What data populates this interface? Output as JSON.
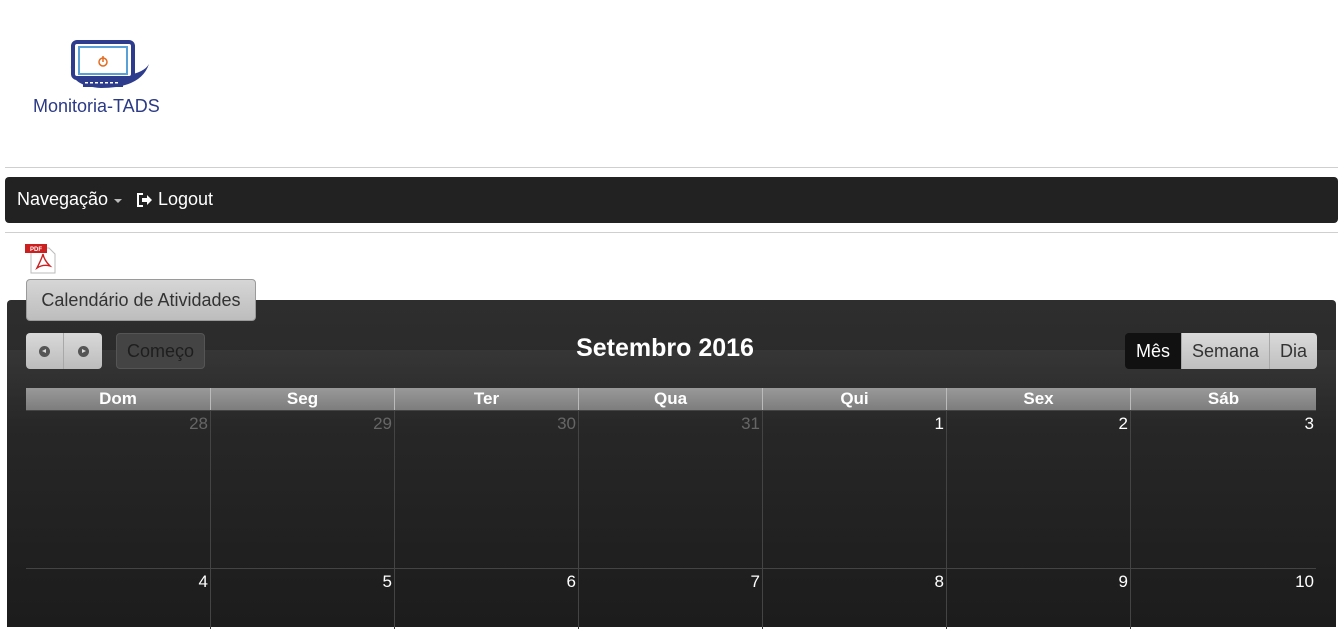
{
  "logo": {
    "text": "Monitoria-TADS",
    "icon": "computer-power-icon"
  },
  "navbar": {
    "navigation_label": "Navegação",
    "logout_label": "Logout"
  },
  "pdf_icon": {
    "label": "PDF"
  },
  "calendar": {
    "tab_label": "Calendário de Atividades",
    "title": "Setembro 2016",
    "today_label": "Começo",
    "views": [
      "Mês",
      "Semana",
      "Dia"
    ],
    "active_view": "Mês",
    "weekdays": [
      "Dom",
      "Seg",
      "Ter",
      "Qua",
      "Qui",
      "Sex",
      "Sáb"
    ],
    "weeks": [
      [
        {
          "d": "28",
          "other": true
        },
        {
          "d": "29",
          "other": true
        },
        {
          "d": "30",
          "other": true
        },
        {
          "d": "31",
          "other": true
        },
        {
          "d": "1",
          "other": false
        },
        {
          "d": "2",
          "other": false
        },
        {
          "d": "3",
          "other": false
        }
      ],
      [
        {
          "d": "4",
          "other": false
        },
        {
          "d": "5",
          "other": false
        },
        {
          "d": "6",
          "other": false
        },
        {
          "d": "7",
          "other": false
        },
        {
          "d": "8",
          "other": false
        },
        {
          "d": "9",
          "other": false
        },
        {
          "d": "10",
          "other": false
        }
      ]
    ]
  }
}
